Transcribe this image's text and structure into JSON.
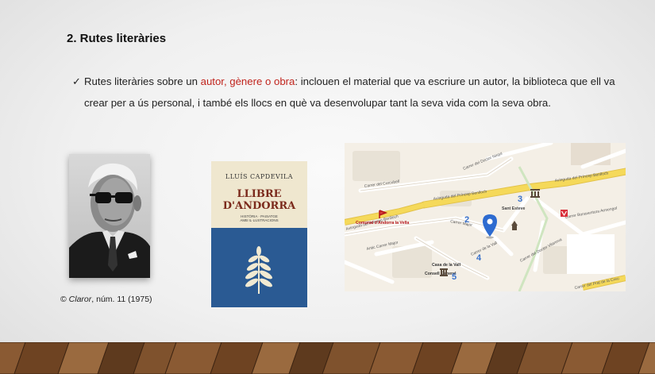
{
  "slide": {
    "title": "2. Rutes literàries",
    "bullet_check": "✓",
    "bullet_pre": "Rutes literàries sobre un ",
    "bullet_highlight": "autor, gènere o obra",
    "bullet_post": ": inclouen el material que va escriure un autor, la biblioteca que ell va crear per a ús personal, i també els llocs en què va desenvolupar tant la seva vida com la seva obra."
  },
  "photo": {
    "caption_symbol": "©",
    "caption_title": "Claror",
    "caption_rest": ", núm. 11 (1975)"
  },
  "book": {
    "author": "LLUÍS CAPDEVILA",
    "title_line1": "LLIBRE",
    "title_line2": "D'ANDORRA",
    "subtitle": "HISTÒRIA · PAISATGE",
    "subtitle2": "AMB IL·LUSTRACIONS"
  },
  "map": {
    "streets": {
      "doctor_nequi": "Carrer del Doctor Nequi",
      "avinguda_1": "Avinguda del Príncep Benlloch",
      "avinguda_2": "Avinguda del Príncep Benlloch",
      "avinguda_3": "Avinguda del Príncep Benlloch",
      "curcull": "Carrer del Curcubell",
      "major": "Carrer Major",
      "antic_major": "Antic Carrer Major",
      "vall": "Carrer de la Vall",
      "doctor_vilanova": "Carrer del Doctor Vilanova",
      "prat_creu": "Carrer del Prat de la Creu",
      "bonaventura": "Carrer Bonaventura Armengol"
    },
    "places": {
      "comunal": "Comunal d'Andorra la Vella",
      "sant_esteve": "Sant Esteve",
      "casa_vall": "Casa de la Vall",
      "consell": "Consell General"
    },
    "markers": [
      "2",
      "3",
      "4",
      "5"
    ]
  },
  "colors": {
    "highlight": "#c0241d",
    "marker_blue": "#2d6bd0",
    "road_yellow": "#f5d95a",
    "book_blue": "#2a5a93"
  }
}
